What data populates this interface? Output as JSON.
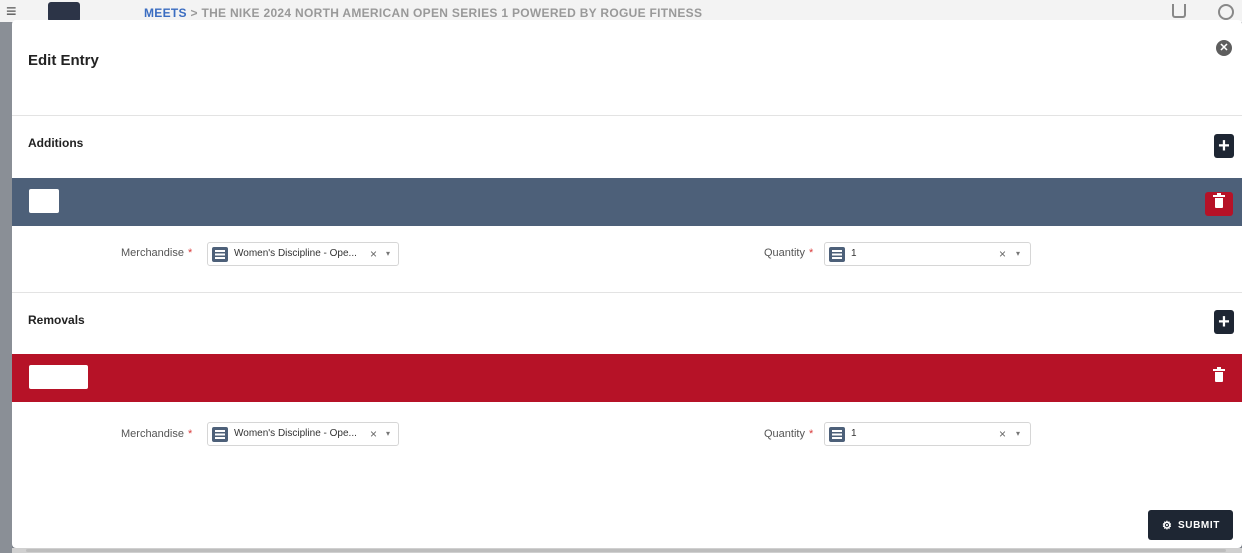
{
  "background": {
    "breadcrumb_first": "MEETS",
    "breadcrumb_sep": ">",
    "breadcrumb_current": "THE NIKE 2024 NORTH AMERICAN OPEN SERIES 1 POWERED BY ROGUE FITNESS"
  },
  "modal": {
    "title": "Edit Entry",
    "close_icon": "✕"
  },
  "additions": {
    "label": "Additions",
    "add_icon": "+",
    "merchandise_label": "Merchandise",
    "merchandise_value": "Women's Discipline - Ope...",
    "quantity_label": "Quantity",
    "quantity_value": "1"
  },
  "removals": {
    "label": "Removals",
    "add_icon": "+",
    "merchandise_label": "Merchandise",
    "merchandise_value": "Women's Discipline - Ope...",
    "quantity_label": "Quantity",
    "quantity_value": "1"
  },
  "common": {
    "required_mark": "*",
    "clear_icon": "×",
    "caret_icon": "▾"
  },
  "submit": {
    "label": "SUBMIT",
    "icon": "⚙"
  },
  "colors": {
    "additions_band": "#4d6079",
    "removals_band": "#b61227",
    "dark_button": "#1e2633",
    "delete_button": "#b61227"
  }
}
